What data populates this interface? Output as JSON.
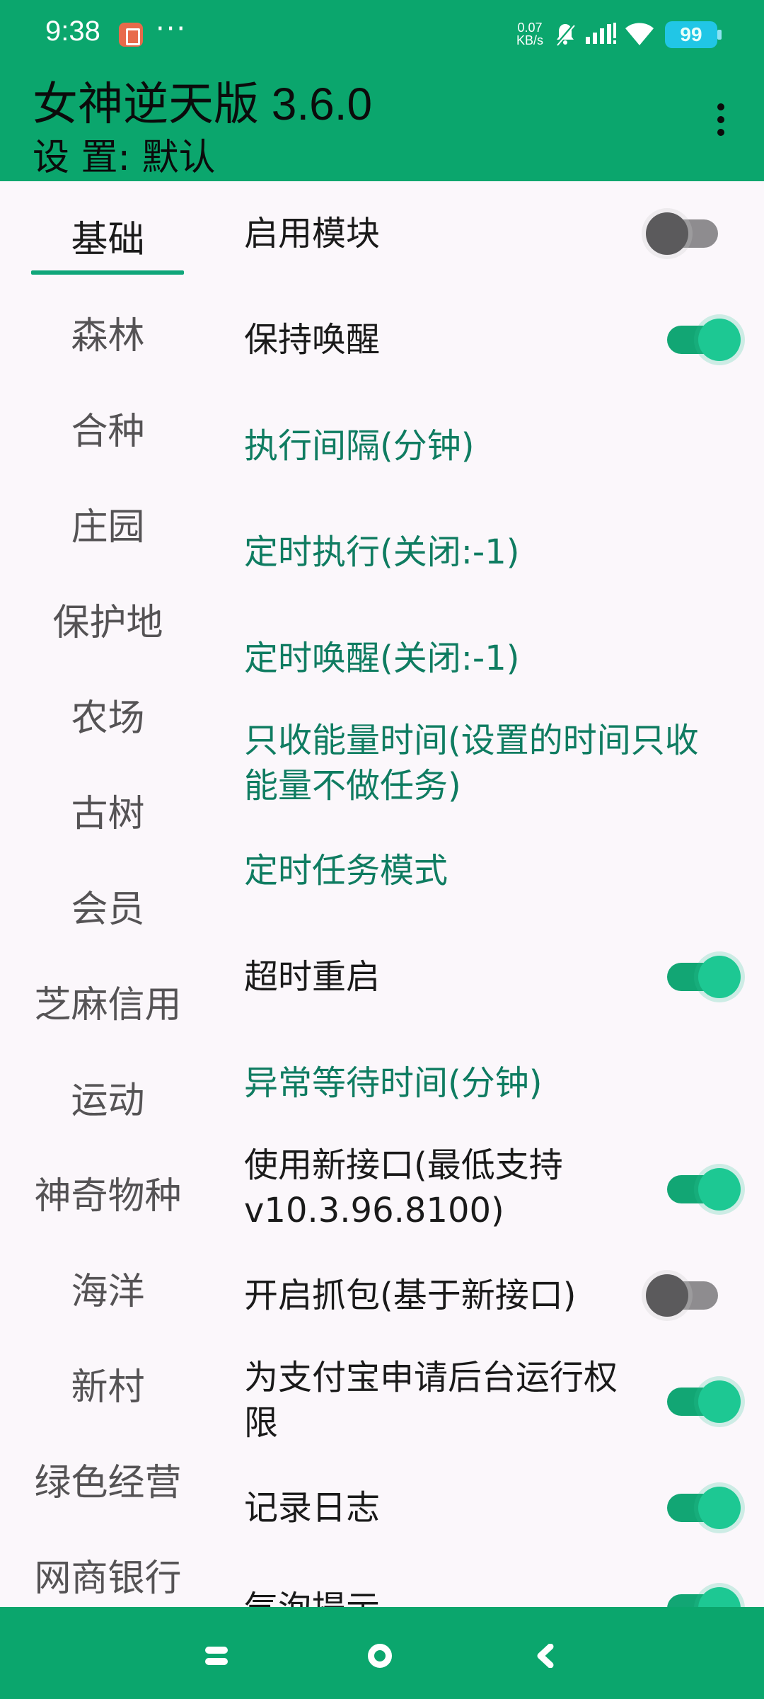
{
  "status_bar": {
    "time": "9:38",
    "more": "···",
    "net_speed_value": "0.07",
    "net_speed_unit": "KB/s",
    "battery": "99",
    "colors": {
      "battery": "#21C6E6"
    }
  },
  "app_bar": {
    "title": "女神逆天版 3.6.0",
    "subtitle": "设 置: 默认"
  },
  "sidebar": {
    "items": [
      {
        "label": "基础"
      },
      {
        "label": "森林"
      },
      {
        "label": "合种"
      },
      {
        "label": "庄园"
      },
      {
        "label": "保护地"
      },
      {
        "label": "农场"
      },
      {
        "label": "古树"
      },
      {
        "label": "会员"
      },
      {
        "label": "芝麻信用"
      },
      {
        "label": "运动"
      },
      {
        "label": "神奇物种"
      },
      {
        "label": "海洋"
      },
      {
        "label": "新村"
      },
      {
        "label": "绿色经营"
      },
      {
        "label": "网商银行"
      }
    ],
    "active_index": 0
  },
  "settings": [
    {
      "label": "启用模块",
      "type": "switch",
      "on": false
    },
    {
      "label": "保持唤醒",
      "type": "switch",
      "on": true
    },
    {
      "label": "执行间隔(分钟)",
      "type": "link"
    },
    {
      "label": "定时执行(关闭:-1)",
      "type": "link"
    },
    {
      "label": "定时唤醒(关闭:-1)",
      "type": "link"
    },
    {
      "label": "只收能量时间(设置的时间只收能量不做任务)",
      "type": "link"
    },
    {
      "label": "定时任务模式",
      "type": "link"
    },
    {
      "label": "超时重启",
      "type": "switch",
      "on": true
    },
    {
      "label": "异常等待时间(分钟)",
      "type": "link"
    },
    {
      "label": "使用新接口(最低支持v10.3.96.8100)",
      "type": "switch",
      "on": true
    },
    {
      "label": "开启抓包(基于新接口)",
      "type": "switch",
      "on": false
    },
    {
      "label": "为支付宝申请后台运行权限",
      "type": "switch",
      "on": true
    },
    {
      "label": "记录日志",
      "type": "switch",
      "on": true
    },
    {
      "label": "气泡提示",
      "type": "switch",
      "on": true
    }
  ],
  "colors": {
    "header": "#0BA66D",
    "accent": "#0F7C61",
    "switch_on": "#1DC893",
    "switch_off": "#5B5A5C"
  }
}
